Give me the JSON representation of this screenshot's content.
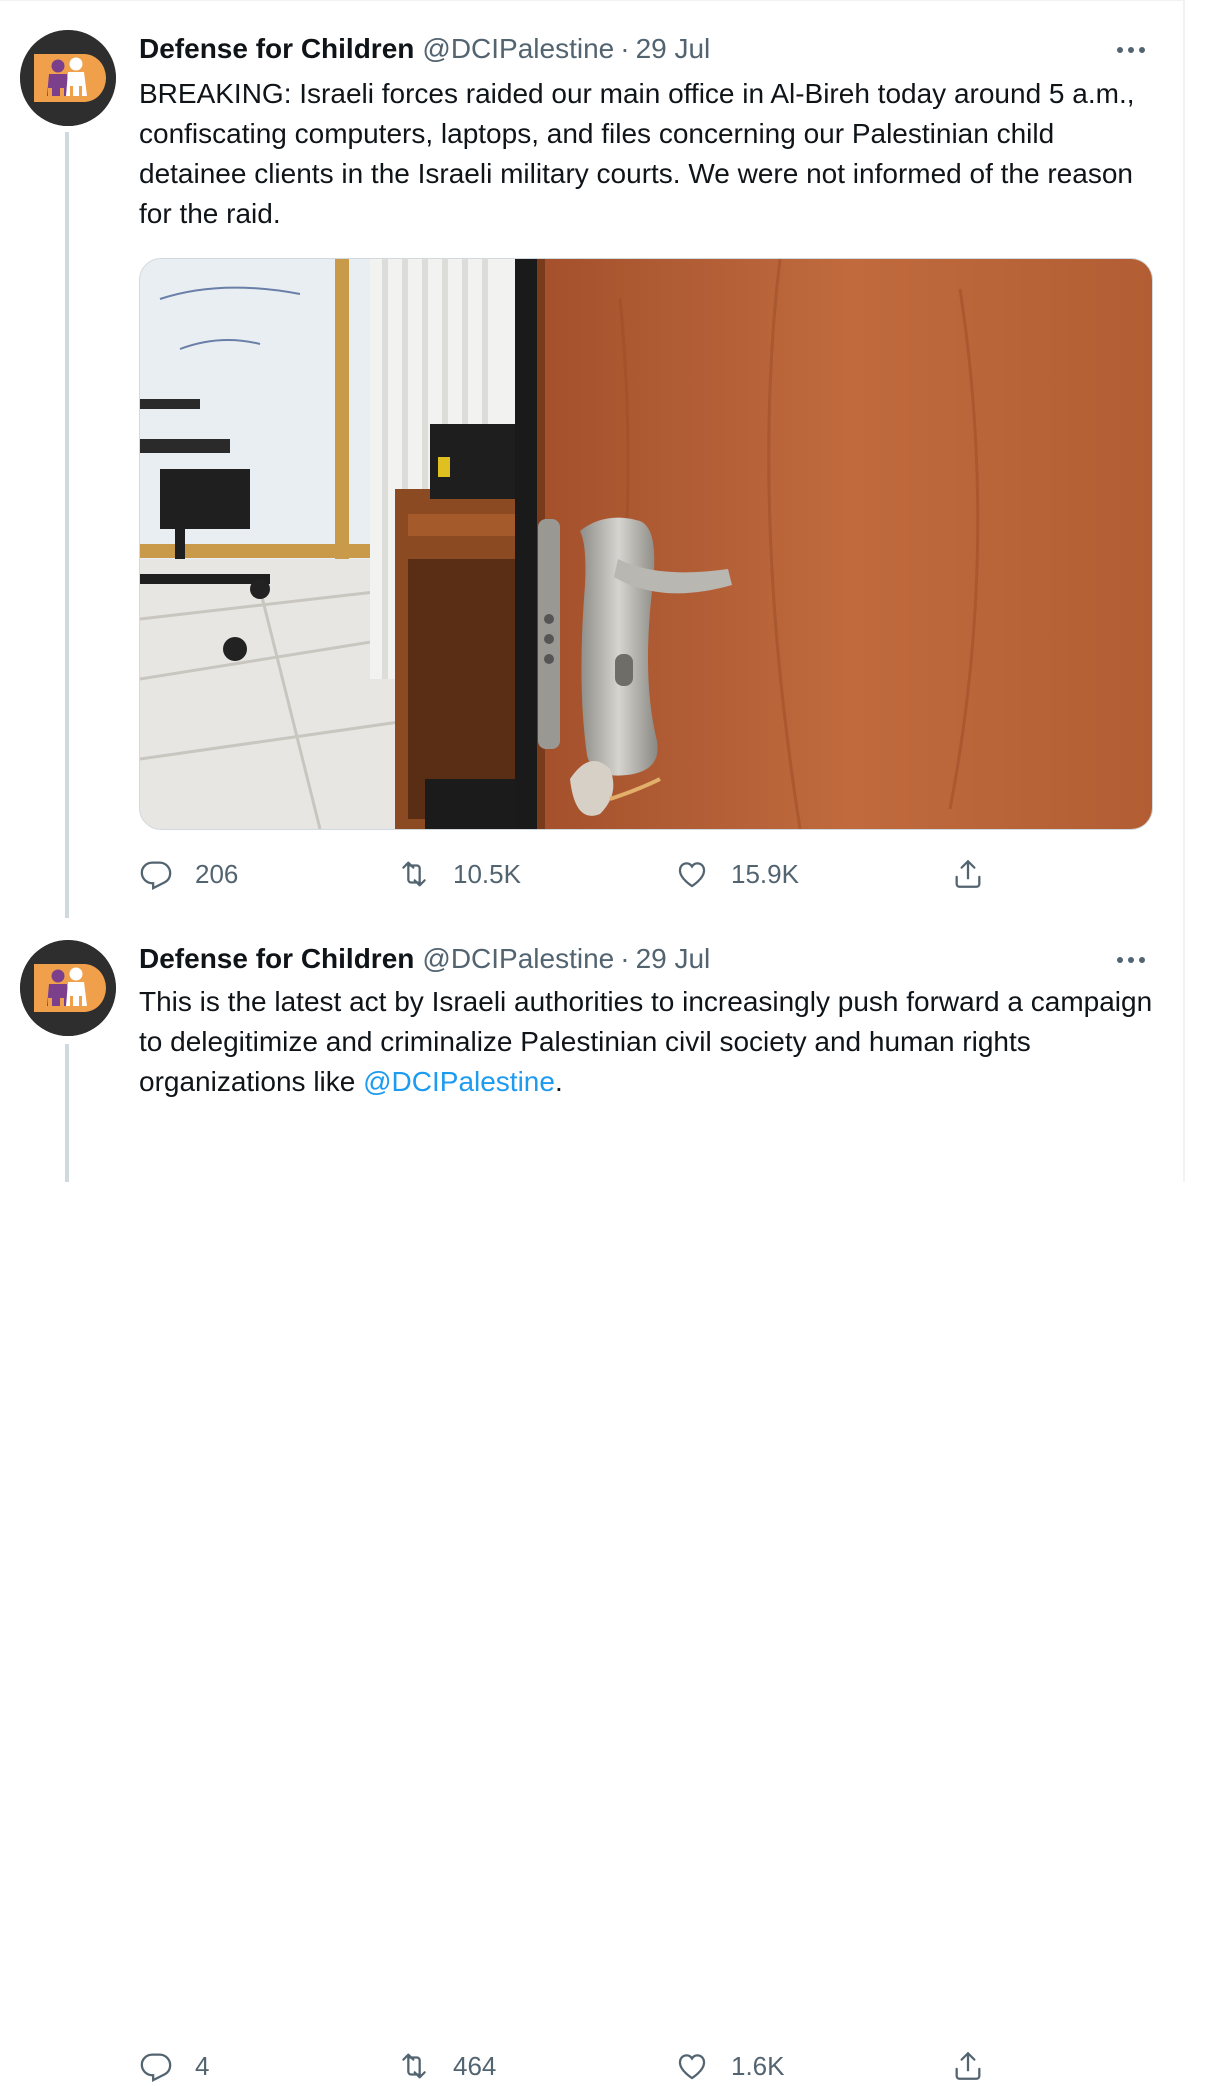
{
  "tweets": [
    {
      "author_name": "Defense for Children",
      "handle": "@DCIPalestine",
      "separator": "·",
      "date": "29 Jul",
      "text": "BREAKING: Israeli forces raided our main office in Al-Bireh today around 5 a.m., confiscating computers, laptops, and files concerning our Palestinian child detainee clients in the Israeli military courts. We were not informed of the reason for the raid.",
      "stats": {
        "replies": "206",
        "retweets": "10.5K",
        "likes": "15.9K"
      },
      "has_image": true
    },
    {
      "author_name": "Defense for Children",
      "handle": "@DCIPalestine",
      "separator": "·",
      "date": "29 Jul",
      "text": "This is the latest act by Israeli authorities to increasingly push forward a campaign to delegitimize and criminalize Palestinian civil society and human rights organizations like ",
      "mention": "@DCIPalestine",
      "text_end": ".",
      "stats": {
        "replies": "4",
        "retweets": "464",
        "likes": "1.6K"
      },
      "has_image": false
    }
  ],
  "colors": {
    "text_primary": "#0f1419",
    "text_secondary": "#536471",
    "link": "#1d9bf0",
    "thread_line": "#cfd9de",
    "avatar_orange": "#f0a04b",
    "avatar_purple": "#7b3f8c"
  },
  "icons": [
    "more-icon",
    "reply-icon",
    "retweet-icon",
    "like-icon",
    "share-icon"
  ]
}
